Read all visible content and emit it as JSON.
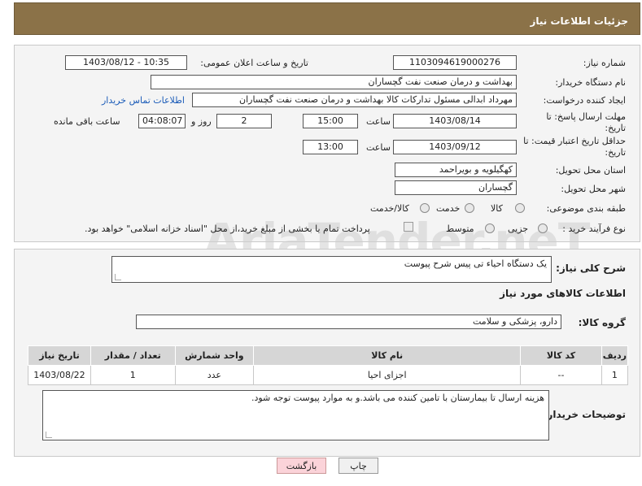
{
  "header": {
    "title": "جزئیات اطلاعات نیاز"
  },
  "form": {
    "need_number_label": "شماره نیاز:",
    "need_number": "1103094619000276",
    "announce_label": "تاریخ و ساعت اعلان عمومی:",
    "announce_value": "1403/08/12 - 10:35",
    "buyer_org_label": "نام دستگاه خریدار:",
    "buyer_org": "بهداشت و درمان صنعت نفت گچساران",
    "requester_label": "ایجاد کننده درخواست:",
    "requester": "مهرداد ابدالی مسئول تدارکات کالا  بهداشت و درمان صنعت نفت گچساران",
    "contact_link": "اطلاعات تماس خریدار",
    "reply_deadline_label": "مهلت ارسال پاسخ: تا تاریخ:",
    "reply_date": "1403/08/14",
    "time_label": "ساعت",
    "reply_time": "15:00",
    "days_value": "2",
    "days_label": "روز و",
    "remaining_time": "04:08:07",
    "remaining_label": "ساعت باقی مانده",
    "price_validity_label": "حداقل تاریخ اعتبار قیمت: تا تاریخ:",
    "price_date": "1403/09/12",
    "price_time": "13:00",
    "province_label": "استان محل تحویل:",
    "province": "کهگیلویه و بویراحمد",
    "city_label": "شهر محل تحویل:",
    "city": "گچساران",
    "category_label": "طبقه بندی موضوعی:",
    "category_options": [
      "کالا",
      "خدمت",
      "کالا/خدمت"
    ],
    "process_label": "نوع فرآیند خرید :",
    "process_options": [
      "جزیی",
      "متوسط"
    ],
    "payment_note": "پرداخت تمام یا بخشی از مبلغ خرید،از محل \"اسناد خزانه اسلامی\" خواهد بود."
  },
  "details": {
    "summary_label": "شرح کلی نیاز:",
    "summary": "یک دستگاه احیاء تی پیس شرح پیوست",
    "goods_info_title": "اطلاعات کالاهای مورد نیاز",
    "group_label": "گروه کالا:",
    "group": "دارو، پزشکی و سلامت",
    "table_headers": [
      "ردیف",
      "کد کالا",
      "نام کالا",
      "واحد شمارش",
      "تعداد / مقدار",
      "تاریخ نیاز"
    ],
    "rows": [
      [
        "1",
        "--",
        "اجزای احیا",
        "عدد",
        "1",
        "1403/08/22"
      ]
    ],
    "buyer_notes_label": "توضیحات خریدار:",
    "buyer_notes": "هزینه ارسال تا بیمارستان با تامین کننده می باشد.و به موارد پیوست توجه شود."
  },
  "buttons": {
    "print": "چاپ",
    "back": "بازگشت"
  },
  "watermark": "AriaTender.neT",
  "colors": {
    "header_bg": "#8b7248",
    "link": "#1a5bb8",
    "back_button": "#fbd3d9"
  }
}
